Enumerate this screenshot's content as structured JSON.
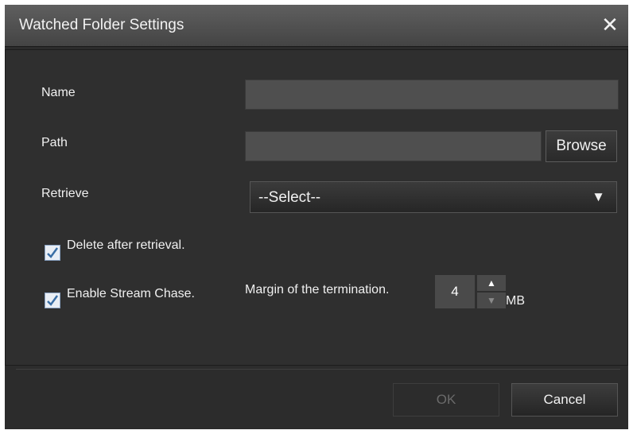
{
  "window": {
    "title": "Watched Folder Settings",
    "close_glyph": "✕"
  },
  "form": {
    "name_label": "Name",
    "name_value": "",
    "path_label": "Path",
    "path_value": "",
    "browse_label": "Browse",
    "retrieve_label": "Retrieve",
    "retrieve_selected": "--Select--",
    "retrieve_arrow": "▼",
    "delete_after_label": "Delete after retrieval.",
    "delete_after_checked": true,
    "stream_chase_label": "Enable Stream Chase.",
    "stream_chase_checked": true,
    "margin_label": "Margin of the termination.",
    "margin_value": "4",
    "margin_unit": "MB",
    "stepper_up_glyph": "▲",
    "stepper_down_glyph": "▼"
  },
  "buttons": {
    "ok_label": "OK",
    "ok_enabled": false,
    "cancel_label": "Cancel"
  },
  "colors": {
    "background": "#2f2f2f",
    "titlebar": "#4f4f4f",
    "field": "#4f4f4f",
    "check": "#3a6ea5"
  }
}
